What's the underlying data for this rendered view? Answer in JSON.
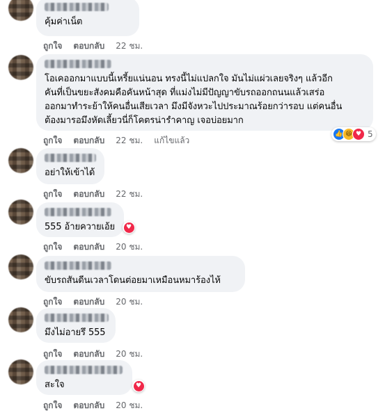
{
  "colors": {
    "bubble": "#f0f2f5",
    "meta_text": "#65676b",
    "love": "#f02849",
    "like": "#1877f2",
    "haha": "#f7b928"
  },
  "labels": {
    "like": "ถูกใจ",
    "reply": "ตอบกลับ",
    "edited": "แก้ไขแล้ว"
  },
  "comments": [
    {
      "text": "คุ้มค่าเน็ต",
      "time": "22 ชม."
    },
    {
      "text": "โอเคออกมาแบบนี้เหรี้ยแน่นอน ทรงนี้ไม่แปลกใจ มันไม่แผ่วเลยจริงๆ แล้วอีก\nคันที่เป็นขยะสังคมคือคันหน้าสุด ที่แม่งไม่มีปัญญาขับรถออกถนนแล้วเสร่อ\nออกมาทำระย้าให้คนอื่นเสียเวลา มึงมีจังหวะไปประมาณร้อยกว่ารอบ แต่คนอื่น\nต้องมารอมึงหัดเลี้ยวนี่ก็โคตรน่ารำคาญ เจอบ่อยมาก",
      "time": "22 ชม.",
      "reactions": {
        "icons": [
          "like-icon",
          "haha-icon",
          "love-icon"
        ],
        "count": "5"
      }
    },
    {
      "text": "อย่าให้เข้าได้",
      "time": "22 ชม."
    },
    {
      "text": "555 อ้ายควายเอ้ย",
      "time": "20 ชม.",
      "reaction_icon": "love-icon"
    },
    {
      "text": "ขับรถสันดีนเวลาโดนต่อยมาเหมือนหมาร้องไห้",
      "time": "20 ชม."
    },
    {
      "text": "มึงไม่อายรึ 555",
      "time": "20 ชม."
    },
    {
      "text": "สะใจ",
      "time": "20 ชม.",
      "reaction_icon": "love-icon"
    }
  ]
}
